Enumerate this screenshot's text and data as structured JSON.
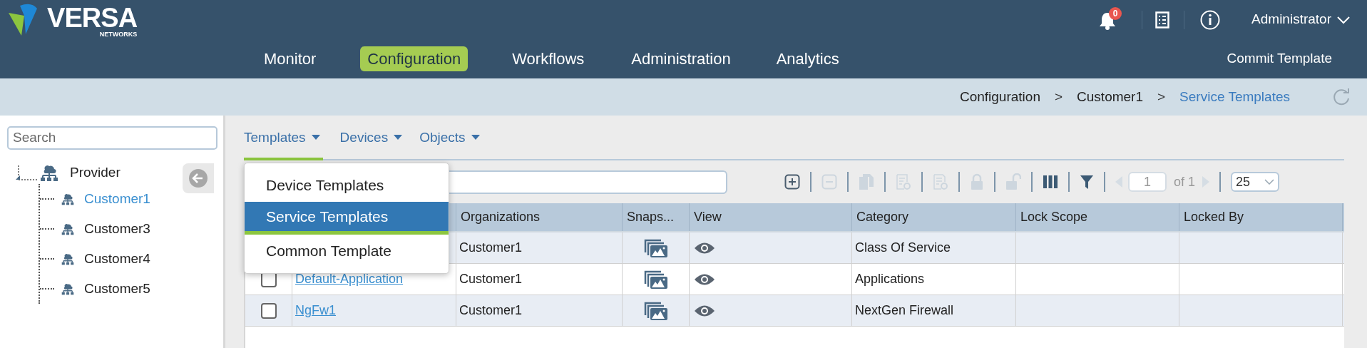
{
  "logo": {
    "name": "VERSA",
    "tagline": "NETWORKS"
  },
  "header": {
    "notifications": "0",
    "user": "Administrator"
  },
  "nav": [
    {
      "label": "Monitor",
      "selected": false
    },
    {
      "label": "Configuration",
      "selected": true
    },
    {
      "label": "Workflows",
      "selected": false
    },
    {
      "label": "Administration",
      "selected": false
    },
    {
      "label": "Analytics",
      "selected": false
    }
  ],
  "commit_button": "Commit Template",
  "breadcrumb": [
    {
      "kind": "link",
      "label": "Configuration",
      "current": false
    },
    {
      "kind": "separator",
      "label": ">"
    },
    {
      "kind": "link",
      "label": "Customer1",
      "current": false
    },
    {
      "kind": "separator",
      "label": ">"
    },
    {
      "kind": "link",
      "label": "Service Templates",
      "current": true
    }
  ],
  "sidebar": {
    "search": {
      "placeholder": "Search"
    },
    "tree": [
      {
        "label": "Provider",
        "selected": false,
        "children": [
          {
            "label": "Customer1",
            "selected": true
          },
          {
            "label": "Customer3",
            "selected": false
          },
          {
            "label": "Customer4",
            "selected": false
          },
          {
            "label": "Customer5",
            "selected": false
          }
        ]
      }
    ]
  },
  "tabs": [
    {
      "label": "Templates",
      "selected": true
    },
    {
      "label": "Devices",
      "selected": false
    },
    {
      "label": "Objects",
      "selected": false
    }
  ],
  "dropdown": [
    {
      "label": "Device Templates",
      "selected": false
    },
    {
      "label": "Service Templates",
      "selected": true
    },
    {
      "label": "Common Template",
      "selected": false
    }
  ],
  "toolbar": [
    {
      "kind": "add",
      "disabled": false
    },
    {
      "kind": "remove",
      "disabled": true
    },
    {
      "kind": "copy",
      "disabled": true
    },
    {
      "kind": "list-gear",
      "disabled": true
    },
    {
      "kind": "list-export",
      "disabled": true
    },
    {
      "kind": "lock",
      "disabled": true
    },
    {
      "kind": "unlock",
      "disabled": true
    },
    {
      "kind": "columns",
      "disabled": false
    },
    {
      "kind": "filter",
      "disabled": false
    }
  ],
  "pager": {
    "prev_disabled": true,
    "page": "1",
    "total": "of 1",
    "next_disabled": true,
    "page_size": "25"
  },
  "table": {
    "columns": [
      "Organizations",
      "Snaps...",
      "View",
      "Category",
      "Lock Scope",
      "Locked By"
    ],
    "rows": [
      {
        "organization": "Customer1",
        "category": "Class Of Service"
      },
      {
        "checked": false,
        "name": "Default-Application",
        "organization": "Customer1",
        "category": "Applications"
      },
      {
        "checked": false,
        "name": "NgFw1",
        "organization": "Customer1",
        "category": "NextGen Firewall"
      }
    ]
  }
}
